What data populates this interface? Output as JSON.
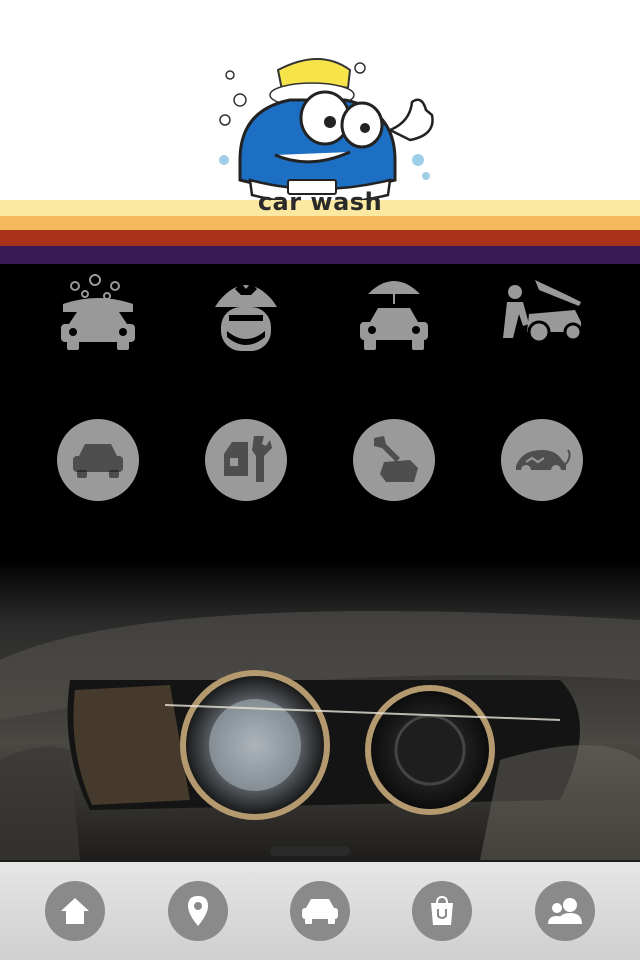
{
  "brand": {
    "logo_text": "car wash"
  },
  "colors": {
    "stripe_1": "#fbe9a1",
    "stripe_2": "#f6b95c",
    "stripe_3": "#a9321a",
    "stripe_4": "#3a1a56",
    "icon_gray": "#9a9a9a",
    "tab_gray": "#8a8a8a"
  },
  "services_row1": [
    {
      "icon": "car-foam-wash-icon"
    },
    {
      "icon": "mechanic-staff-icon"
    },
    {
      "icon": "car-umbrella-protection-icon"
    },
    {
      "icon": "engine-repair-icon"
    }
  ],
  "services_row2": [
    {
      "icon": "car-front-icon"
    },
    {
      "icon": "car-wrench-service-icon"
    },
    {
      "icon": "hand-wrench-icon"
    },
    {
      "icon": "car-charging-icon"
    }
  ],
  "tabbar": [
    {
      "icon": "home-icon"
    },
    {
      "icon": "location-pin-icon"
    },
    {
      "icon": "car-icon"
    },
    {
      "icon": "shopping-bag-icon"
    },
    {
      "icon": "users-icon"
    }
  ]
}
